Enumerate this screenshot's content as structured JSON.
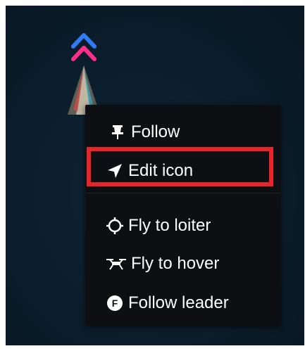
{
  "context_menu": {
    "items": [
      {
        "label": "Follow",
        "icon": "pin-icon"
      },
      {
        "label": "Edit icon",
        "icon": "navigation-arrow-icon"
      },
      {
        "label": "Fly to loiter",
        "icon": "loiter-target-icon"
      },
      {
        "label": "Fly to hover",
        "icon": "drone-icon"
      },
      {
        "label": "Follow leader",
        "icon": "follow-leader-f-icon"
      }
    ]
  },
  "vehicle": {
    "chevron_colors": [
      "#2f7cf6",
      "#ff2e8a"
    ]
  },
  "highlight_color": "#e8232a"
}
